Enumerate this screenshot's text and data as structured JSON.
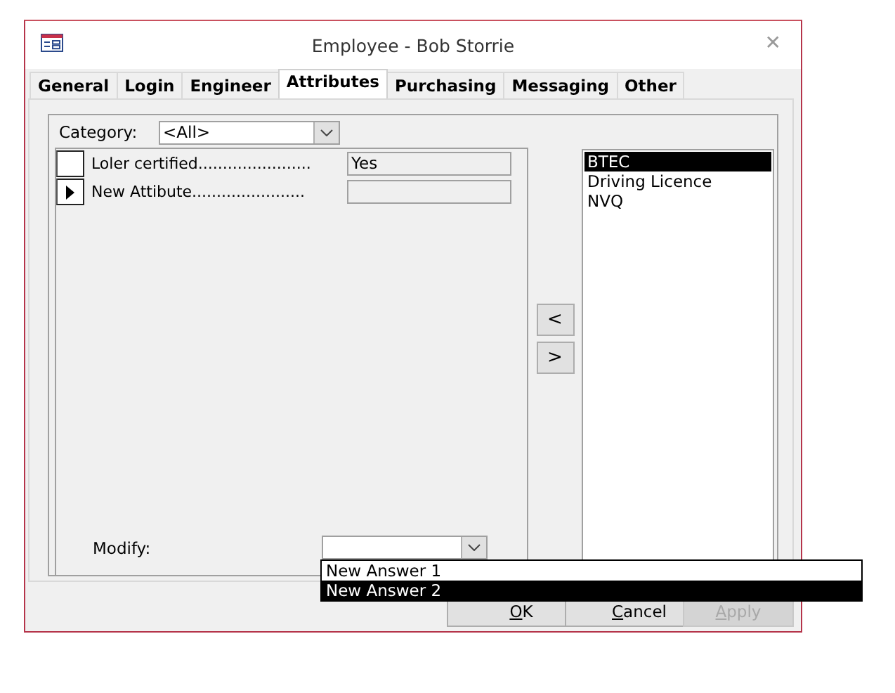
{
  "window": {
    "title": "Employee - Bob Storrie",
    "close": "✕"
  },
  "tabs": [
    {
      "label": "General",
      "selected": false
    },
    {
      "label": "Login",
      "selected": false
    },
    {
      "label": "Engineer",
      "selected": false
    },
    {
      "label": "Attributes",
      "selected": true
    },
    {
      "label": "Purchasing",
      "selected": false
    },
    {
      "label": "Messaging",
      "selected": false
    },
    {
      "label": "Other",
      "selected": false
    }
  ],
  "category": {
    "label": "Category:",
    "value": "<All>"
  },
  "attributes": [
    {
      "label": "Loler certified.......................",
      "value": "Yes",
      "current": false
    },
    {
      "label": "New Attibute.......................",
      "current": true
    }
  ],
  "modify": {
    "label": "Modify:",
    "options": [
      {
        "label": "New Answer 1",
        "selected": false
      },
      {
        "label": "New Answer 2",
        "selected": true
      }
    ]
  },
  "move_buttons": [
    "<",
    ">"
  ],
  "list": [
    {
      "label": "BTEC",
      "selected": true
    },
    {
      "label": "Driving Licence",
      "selected": false
    },
    {
      "label": "NVQ",
      "selected": false
    }
  ],
  "buttons": [
    {
      "label": "OK",
      "disabled": false
    },
    {
      "label": "Cancel",
      "disabled": false
    },
    {
      "label": "Apply",
      "disabled": true
    }
  ]
}
